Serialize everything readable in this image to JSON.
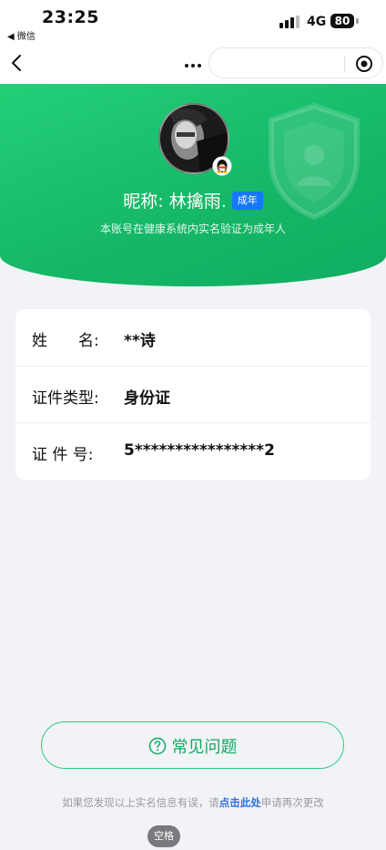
{
  "status_bar": {
    "time": "23:25",
    "back_app": "◀ 微信",
    "network": "4G",
    "battery": "80"
  },
  "nav": {
    "back_icon": "chevron-left-icon",
    "more_icon": "more-dots-icon",
    "close_icon": "target-close-icon"
  },
  "profile": {
    "nickname": "昵称: 林擒雨.",
    "adult_badge": "成年",
    "verify_note": "本账号在健康系统内实名验证为成年人",
    "colors": {
      "header_green": "#1bbf6c",
      "badge_blue": "#1677ff"
    }
  },
  "info": {
    "rows": [
      {
        "label": "姓　　名:",
        "value": "**诗"
      },
      {
        "label": "证件类型:",
        "value": "身份证"
      },
      {
        "label": "证 件 号:",
        "value": "5****************2"
      }
    ]
  },
  "faq": {
    "label": "常见问题",
    "icon": "help-circle-icon",
    "accent": "#2ecb80"
  },
  "footer": {
    "prefix": "如果您发现以上实名信息有误，请",
    "link": "点击此处",
    "suffix": "申请再次更改",
    "space_key": "空格"
  }
}
